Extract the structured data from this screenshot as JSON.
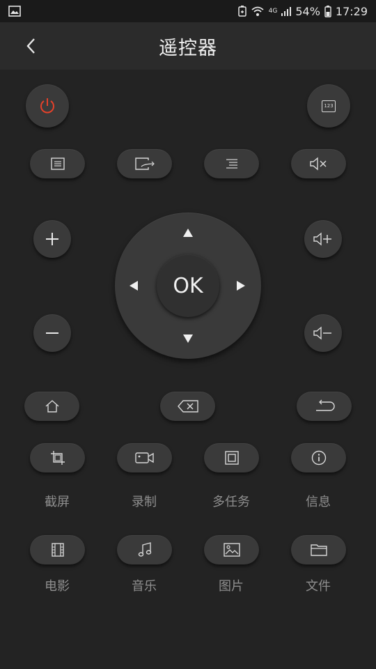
{
  "status_bar": {
    "battery": "54%",
    "time": "17:29",
    "network": "4G"
  },
  "header": {
    "title": "遥控器"
  },
  "colors": {
    "power_accent": "#e5412a",
    "background": "#232323",
    "button": "#3a3a3a"
  },
  "top_row": {
    "power_icon": "power-icon",
    "number_pad_label": "123"
  },
  "function_row": [
    "menu-list-icon",
    "input-source-icon",
    "options-icon",
    "mute-icon"
  ],
  "dpad": {
    "ok_label": "OK"
  },
  "features": [
    {
      "label": "截屏",
      "icon": "screenshot-icon"
    },
    {
      "label": "录制",
      "icon": "video-record-icon"
    },
    {
      "label": "多任务",
      "icon": "multitask-icon"
    },
    {
      "label": "信息",
      "icon": "info-icon"
    }
  ],
  "media": [
    {
      "label": "电影",
      "icon": "film-icon"
    },
    {
      "label": "音乐",
      "icon": "music-icon"
    },
    {
      "label": "图片",
      "icon": "image-icon"
    },
    {
      "label": "文件",
      "icon": "folder-icon"
    }
  ]
}
